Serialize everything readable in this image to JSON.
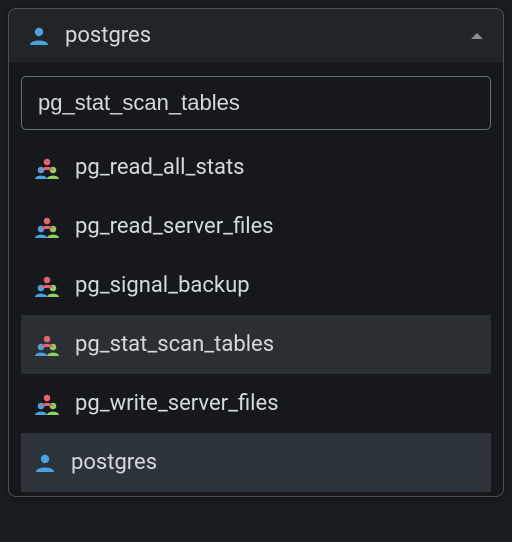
{
  "header": {
    "selected_label": "postgres"
  },
  "search": {
    "value": "pg_stat_scan_tables"
  },
  "items": [
    {
      "label": "pg_read_all_stats",
      "type": "group",
      "highlight": false,
      "selected": false
    },
    {
      "label": "pg_read_server_files",
      "type": "group",
      "highlight": false,
      "selected": false
    },
    {
      "label": "pg_signal_backup",
      "type": "group",
      "highlight": false,
      "selected": false
    },
    {
      "label": "pg_stat_scan_tables",
      "type": "group",
      "highlight": true,
      "selected": false
    },
    {
      "label": "pg_write_server_files",
      "type": "group",
      "highlight": false,
      "selected": false
    },
    {
      "label": "postgres",
      "type": "user",
      "highlight": false,
      "selected": true
    }
  ]
}
